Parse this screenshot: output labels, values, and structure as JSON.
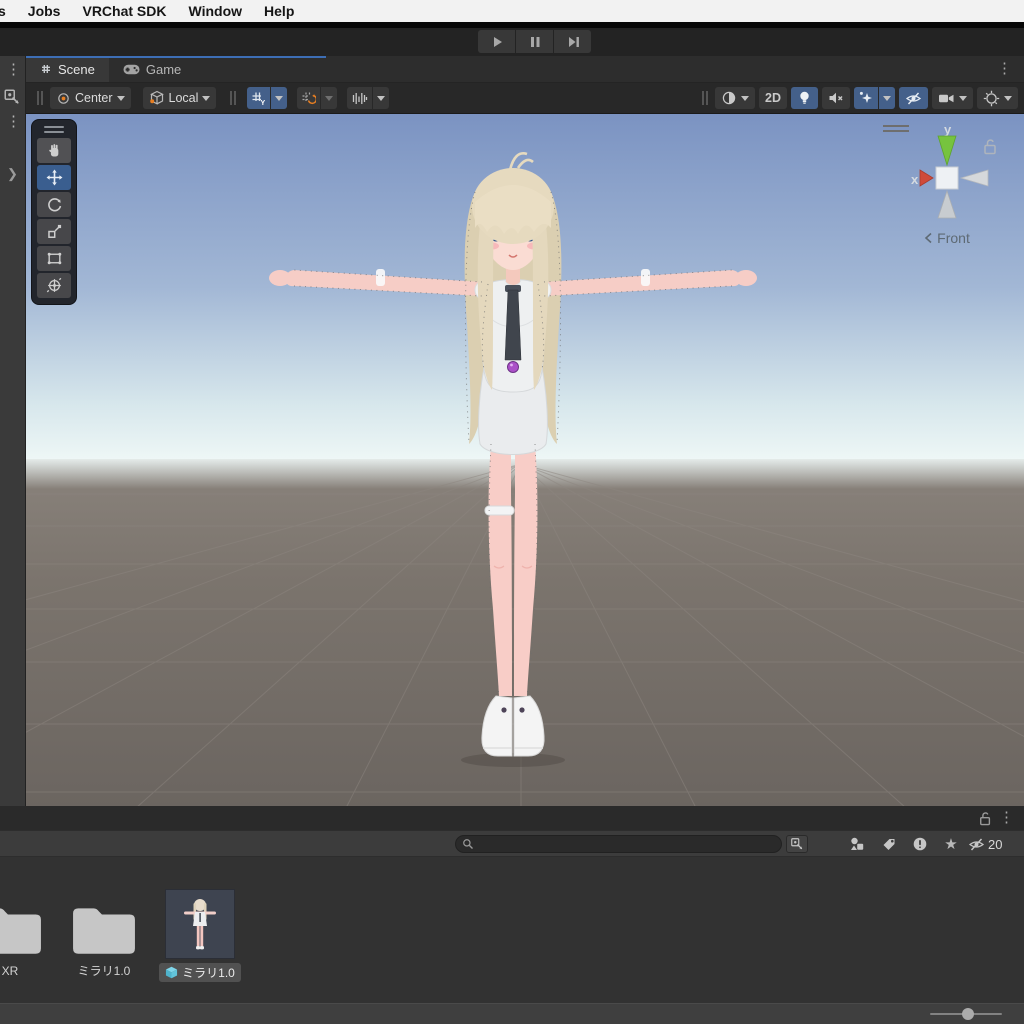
{
  "menu_bar": {
    "items": [
      "s",
      "Jobs",
      "VRChat SDK",
      "Window",
      "Help"
    ]
  },
  "scene_panel": {
    "tabs": {
      "scene": "Scene",
      "game": "Game"
    },
    "toolbar": {
      "pivot": "Center",
      "rotation": "Local",
      "two_d": "2D"
    },
    "tools": [
      "hand",
      "move",
      "rotate",
      "scale",
      "rect",
      "transform"
    ],
    "active_tool": "move",
    "gizmo": {
      "x": "x",
      "y": "y",
      "view": "Front"
    }
  },
  "project_panel": {
    "search_placeholder": "",
    "hidden_count": "20",
    "assets": [
      {
        "type": "folder",
        "label": "XR"
      },
      {
        "type": "folder",
        "label": "ミラリ1.0"
      },
      {
        "type": "prefab",
        "label": "ミラリ1.0",
        "selected": true
      }
    ]
  },
  "colors": {
    "accent_blue": "#44608a",
    "tab_highlight": "#3d6eb5",
    "sky_top": "#7b93c2",
    "sky_horizon": "#eef7f7",
    "ground": "#77706a",
    "folder": "#c6c6c6",
    "prefab_cube": "#58c4dd",
    "axis_x": "#cf4a3a",
    "axis_y": "#76c33e"
  }
}
